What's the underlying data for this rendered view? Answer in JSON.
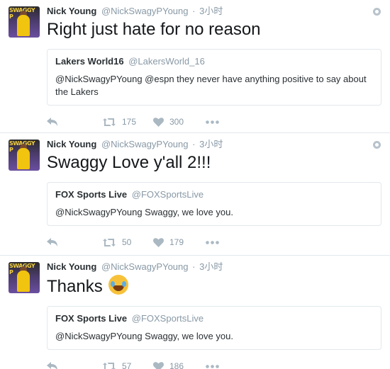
{
  "tweets": [
    {
      "author": {
        "name": "Nick Young",
        "handle": "@NickSwagyPYoung"
      },
      "time": "3小时",
      "text": "Right just hate for no reason",
      "quote": {
        "name": "Lakers World16",
        "handle": "@LakersWorld_16",
        "text": "@NickSwagyPYoung @espn they never have anything positive to say about the Lakers"
      },
      "retweets": "175",
      "likes": "300"
    },
    {
      "author": {
        "name": "Nick Young",
        "handle": "@NickSwagyPYoung"
      },
      "time": "3小时",
      "text": "Swaggy Love y'all 2!!!",
      "quote": {
        "name": "FOX Sports Live",
        "handle": "@FOXSportsLive",
        "text": "@NickSwagyPYoung Swaggy, we love you."
      },
      "retweets": "50",
      "likes": "179"
    },
    {
      "author": {
        "name": "Nick Young",
        "handle": "@NickSwagyPYoung"
      },
      "time": "3小时",
      "text": "Thanks",
      "emoji": "face-with-tears-of-joy",
      "quote": {
        "name": "FOX Sports Live",
        "handle": "@FOXSportsLive",
        "text": "@NickSwagyPYoung Swaggy, we love you."
      },
      "retweets": "57",
      "likes": "186"
    }
  ],
  "separator": "·",
  "avatar_text": "SWAGGY P",
  "colors": {
    "secondary_text": "#8899a6",
    "border": "#e1e8ed",
    "primary_text": "#292f33"
  }
}
